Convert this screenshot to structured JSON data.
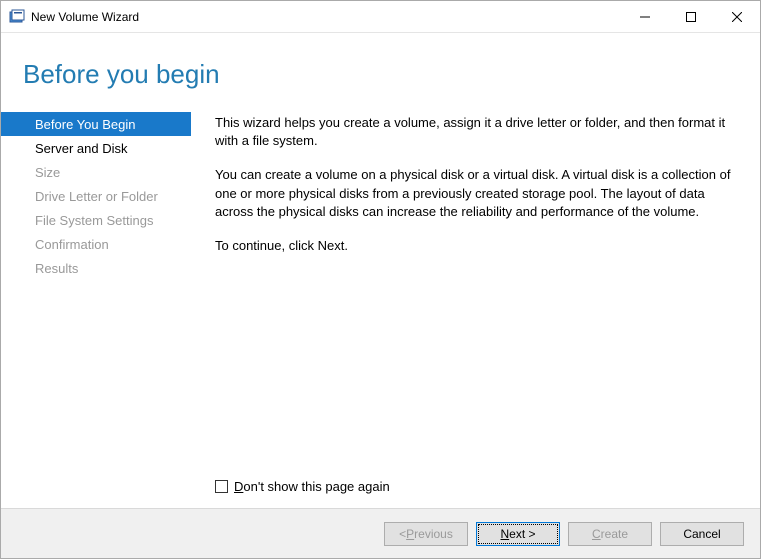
{
  "window": {
    "title": "New Volume Wizard"
  },
  "page_title": "Before you begin",
  "sidebar": {
    "items": [
      {
        "label": "Before You Begin",
        "selected": true,
        "enabled": true
      },
      {
        "label": "Server and Disk",
        "selected": false,
        "enabled": true
      },
      {
        "label": "Size",
        "selected": false,
        "enabled": false
      },
      {
        "label": "Drive Letter or Folder",
        "selected": false,
        "enabled": false
      },
      {
        "label": "File System Settings",
        "selected": false,
        "enabled": false
      },
      {
        "label": "Confirmation",
        "selected": false,
        "enabled": false
      },
      {
        "label": "Results",
        "selected": false,
        "enabled": false
      }
    ]
  },
  "body": {
    "para1": "This wizard helps you create a volume, assign it a drive letter or folder, and then format it with a file system.",
    "para2": "You can create a volume on a physical disk or a virtual disk. A virtual disk is a collection of one or more physical disks from a previously created storage pool. The layout of data across the physical disks can increase the reliability and performance of the volume.",
    "para3": "To continue, click Next.",
    "checkbox_label": "Don't show this page again",
    "checkbox_checked": false
  },
  "footer": {
    "previous": {
      "label": "< Previous",
      "enabled": false
    },
    "next": {
      "label": "Next >",
      "enabled": true,
      "default": true
    },
    "create": {
      "label": "Create",
      "enabled": false
    },
    "cancel": {
      "label": "Cancel",
      "enabled": true
    }
  }
}
